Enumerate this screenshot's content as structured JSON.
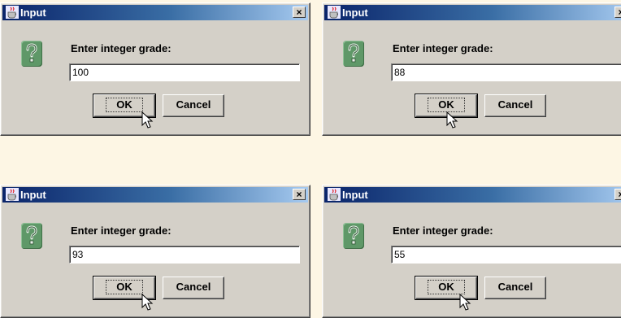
{
  "dialogs": [
    {
      "title": "Input",
      "prompt": "Enter integer grade:",
      "value": "100",
      "ok_label": "OK",
      "cancel_label": "Cancel"
    },
    {
      "title": "Input",
      "prompt": "Enter integer grade:",
      "value": "88",
      "ok_label": "OK",
      "cancel_label": "Cancel"
    },
    {
      "title": "Input",
      "prompt": "Enter integer grade:",
      "value": "93",
      "ok_label": "OK",
      "cancel_label": "Cancel"
    },
    {
      "title": "Input",
      "prompt": "Enter integer grade:",
      "value": "55",
      "ok_label": "OK",
      "cancel_label": "Cancel"
    }
  ],
  "close_glyph": "×",
  "icons": {
    "app": "java-cup-icon",
    "question": "question-icon",
    "cursor": "mouse-cursor-icon"
  },
  "colors": {
    "title_start": "#0a246a",
    "title_end": "#a6caf0",
    "dialog_bg": "#d4d0c8",
    "question_icon": "#5f9868",
    "page_bg": "#fdf6e4"
  }
}
